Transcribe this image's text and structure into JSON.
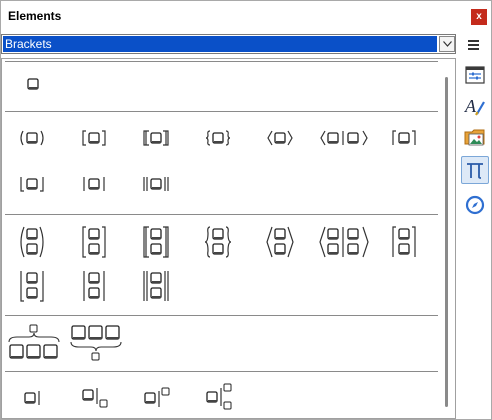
{
  "window": {
    "title": "Elements",
    "close_label": "x"
  },
  "category": {
    "selected": "Brackets"
  },
  "sidebar": {
    "items": [
      {
        "name": "properties",
        "icon": "properties-icon"
      },
      {
        "name": "styles",
        "icon": "styles-icon"
      },
      {
        "name": "gallery",
        "icon": "gallery-icon"
      },
      {
        "name": "elements",
        "icon": "pi-icon",
        "active": true
      },
      {
        "name": "navigator",
        "icon": "compass-icon"
      }
    ],
    "menu_icon": "hamburger-menu-icon"
  },
  "sections": [
    {
      "name": "single",
      "items": [
        "scalable-brackets-box"
      ]
    },
    {
      "name": "brackets",
      "items": [
        "round",
        "square",
        "double-square",
        "curly",
        "angle",
        "angle-pipe",
        "ceil",
        "floor",
        "single-bar",
        "double-bar"
      ]
    },
    {
      "name": "scalable-brackets",
      "items": [
        "round",
        "square",
        "double-square",
        "curly",
        "angle",
        "angle-pipe",
        "ceil",
        "floor",
        "single-bar",
        "double-bar"
      ]
    },
    {
      "name": "braces",
      "items": [
        "overbrace",
        "underbrace"
      ]
    },
    {
      "name": "evaluate",
      "items": [
        "evaluate",
        "evaluate-sub",
        "evaluate-sup",
        "evaluate-subsup"
      ]
    }
  ],
  "colors": {
    "selection": "#0a50c8",
    "close": "#c42b1c",
    "active_tab": "#dde9f7"
  }
}
